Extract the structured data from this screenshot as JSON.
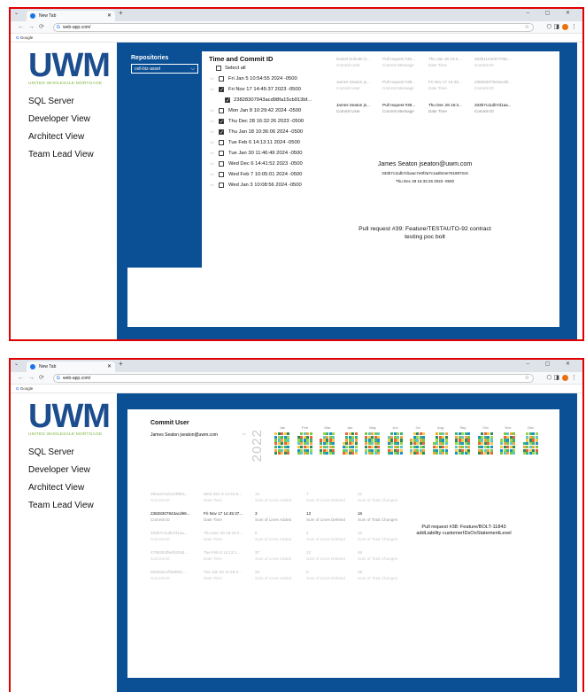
{
  "browser": {
    "tab_title": "New Tab",
    "new_tab_symbol": "+",
    "window_controls": "– ▢ ✕",
    "url": "web-app.com/",
    "bookmark": "Google"
  },
  "sidebar": {
    "logo": "UWM",
    "logo_sub": "UNITED WHOLESALE MORTGAGE",
    "items": [
      "SQL Server",
      "Developer View",
      "Architect View",
      "Team Lead View"
    ]
  },
  "panel1": {
    "repositories_title": "Repositories",
    "repository_selected": "cell-biz-asset",
    "time_commit_title": "Time and Commit ID",
    "rows": [
      {
        "label": "Select all",
        "checked": false,
        "kind": "all"
      },
      {
        "label": "Fri Jan 5 10:54:55 2024 -0500",
        "checked": false,
        "kind": "node"
      },
      {
        "label": "Fri Nov 17 14:45:37 2023 -0500",
        "checked": true,
        "kind": "node"
      },
      {
        "label": "23828307943acd98fa15cb913bf...",
        "checked": true,
        "kind": "sub"
      },
      {
        "label": "Mon Jan 8 10:29:42 2024 -0500",
        "checked": false,
        "kind": "node"
      },
      {
        "label": "Thu Dec 28 16:32:26 2023 -0500",
        "checked": true,
        "kind": "node"
      },
      {
        "label": "Thu Jan 18 10:36:06 2024 -0500",
        "checked": true,
        "kind": "node"
      },
      {
        "label": "Tue Feb 6 14:13:11 2024 -0500",
        "checked": false,
        "kind": "node"
      },
      {
        "label": "Tue Jan 30 11:46:49 2024 -0500",
        "checked": false,
        "kind": "node"
      },
      {
        "label": "Wed Dec 6 14:41:52 2023 -0500",
        "checked": false,
        "kind": "node"
      },
      {
        "label": "Wed Feb 7 10:05:01 2024 -0500",
        "checked": false,
        "kind": "node"
      },
      {
        "label": "Wed Jan 3 10:08:56 2024 -0500",
        "checked": false,
        "kind": "node"
      }
    ],
    "mini_table": [
      {
        "style": "dim",
        "cells": [
          [
            "Daniel Schuler (t...",
            "Commit User"
          ],
          [
            "Pull request #40...",
            "Commit Message"
          ],
          [
            "Thu Jan 18 10:3...",
            "Date Time"
          ],
          [
            "462b11e3e9770dc...",
            "Commit ID"
          ]
        ]
      },
      {
        "style": "dim",
        "cells": [
          [
            "James Seaton js...",
            "Commit User"
          ],
          [
            "Pull request #38...",
            "Commit Message"
          ],
          [
            "Fri Nov 17 14:45...",
            "Date Time"
          ],
          [
            "23828307943acd9...",
            "Commit ID"
          ]
        ]
      },
      {
        "style": "hi",
        "cells": [
          [
            "James Seaton js...",
            "Commit User"
          ],
          [
            "Pull request #39...",
            "Commit Message"
          ],
          [
            "Thu Dec 28 16:3...",
            "Date Time"
          ],
          [
            "333b7c11db7d1aa...",
            "Commit ID"
          ]
        ]
      }
    ],
    "detail_name": "James Seaton jseaton@uwm.com",
    "detail_hash": "333b7c11db7d1aac7e0f3a7c1ad044e7618972c5",
    "detail_date": "Thu Dec 28 16:32:26 2023 -0500",
    "pr_line1": "Pull request #39: Feature/TESTAUTO-92 contract",
    "pr_line2": "testing poc bolt"
  },
  "panel2": {
    "commit_user_title": "Commit User",
    "commit_user_selected": "James Seaton jseaton@uwm.com",
    "year": "2022",
    "months": [
      "Jan",
      "Feb",
      "Mar",
      "Apr",
      "May",
      "Jun",
      "Jul",
      "Aug",
      "Sep",
      "Oct",
      "Nov",
      "Dec"
    ],
    "heatmap_colors": [
      "#f2c94c",
      "#7ac943",
      "#3cb371",
      "#2e8b57",
      "#5fc6c6",
      "#1e90c8",
      "#e8643c",
      "#f4a340",
      "#9ad64a"
    ],
    "rows": [
      {
        "style": "dim",
        "cells": [
          [
            "36ba47ce5123f99c...",
            "Commit ID"
          ],
          [
            "Wed Dec 6 14:41:5...",
            "Date Time"
          ],
          [
            "14",
            "Sum of Lines Added"
          ],
          [
            "7",
            "Sum of Lines Deleted"
          ],
          [
            "21",
            "Sum of Total Changes"
          ]
        ]
      },
      {
        "style": "hi",
        "cells": [
          [
            "23828307943acd98...",
            "Commit ID"
          ],
          [
            "Fri Nov 17 14:45:37...",
            "Date Time"
          ],
          [
            "3",
            "Sum of Lines Added"
          ],
          [
            "13",
            "Sum of Lines Deleted"
          ],
          [
            "16",
            "Sum of Total Changes"
          ]
        ]
      },
      {
        "style": "dim",
        "cells": [
          [
            "333b7c11db7d1aa...",
            "Commit ID"
          ],
          [
            "Thu Dec 28 16:32:2...",
            "Date Time"
          ],
          [
            "8",
            "Sum of Lines Added"
          ],
          [
            "4",
            "Sum of Lines Deleted"
          ],
          [
            "12",
            "Sum of Total Changes"
          ]
        ]
      },
      {
        "style": "dim",
        "cells": [
          [
            "4795304f9ef9326d...",
            "Commit ID"
          ],
          [
            "Tue Feb 6 14:13:1...",
            "Date Time"
          ],
          [
            "37",
            "Sum of Lines Added"
          ],
          [
            "12",
            "Sum of Lines Deleted"
          ],
          [
            "49",
            "Sum of Total Changes"
          ]
        ]
      },
      {
        "style": "dim",
        "cells": [
          [
            "b0683ac1f6a89d1...",
            "Commit ID"
          ],
          [
            "Tue Jan 30 11:46:4...",
            "Date Time"
          ],
          [
            "24",
            "Sum of Lines Added"
          ],
          [
            "5",
            "Sum of Lines Deleted"
          ],
          [
            "29",
            "Sum of Total Changes"
          ]
        ]
      }
    ],
    "pr_line1": "Pull request #38: Feature/BOLT-11843",
    "pr_line2": "addLiability customerIDsOnStatementLevel"
  }
}
